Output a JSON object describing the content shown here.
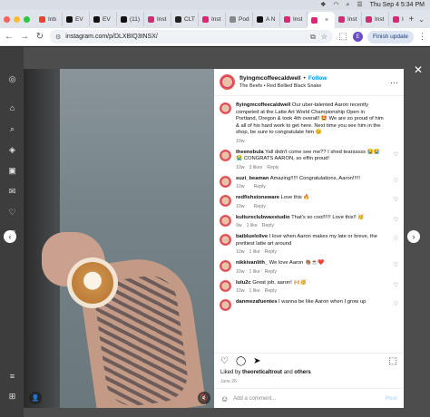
{
  "menubar": {
    "datetime": "Thu Sep 4  5:34 PM"
  },
  "tabs": [
    {
      "label": "Inb",
      "color": "#ea4335",
      "active": false
    },
    {
      "label": "EV",
      "color": "#111111",
      "active": false
    },
    {
      "label": "EV",
      "color": "#111111",
      "active": false
    },
    {
      "label": "(11)",
      "color": "#111111",
      "active": false
    },
    {
      "label": "Inst",
      "color": "#d62976",
      "active": false
    },
    {
      "label": "CLT",
      "color": "#222222",
      "active": false
    },
    {
      "label": "Inst",
      "color": "#d62976",
      "active": false
    },
    {
      "label": "Pod",
      "color": "#888888",
      "active": false
    },
    {
      "label": "A N",
      "color": "#111111",
      "active": false
    },
    {
      "label": "Inst",
      "color": "#d62976",
      "active": false
    },
    {
      "label": "",
      "color": "#d62976",
      "active": true
    },
    {
      "label": "Inst",
      "color": "#d62976",
      "active": false
    },
    {
      "label": "Inst",
      "color": "#d62976",
      "active": false
    },
    {
      "label": "Inst",
      "color": "#d62976",
      "active": false
    }
  ],
  "address": {
    "url": "instagram.com/p/DLXBIQ3tNSX/",
    "finish_update": "Finish update",
    "profile_initial": "E"
  },
  "post": {
    "username": "flyingmcoffeecaldwell",
    "follow": "Follow",
    "audio": "The Beefs • Red Bellied Black Snake",
    "caption_user": "flyingmcoffeecaldwell",
    "caption": "Our uber-talented Aaron recently competed at the Latte Art World Championship Open in Portland, Oregon & took 4th overall! 🤩 We are so proud of him & all of his hard work to get here. Next time you see him in the shop, be sure to congratulate him 😊",
    "caption_age": "10w",
    "likes_prefix": "Liked by",
    "likes_user": "theoreticaltrout",
    "likes_and": "and",
    "likes_others": "others",
    "date": "June 26",
    "add_comment_placeholder": "Add a comment...",
    "post_label": "Post"
  },
  "comments": [
    {
      "user": "theenebula",
      "text": "Yall didn't come see me?? I shed tearsssss 😭😭😭 CONGRATS AARON, so effin proud!",
      "age": "10w",
      "likes": "3 likes",
      "reply": "Reply"
    },
    {
      "user": "suzi_beaman",
      "text": "Amazing!!!!! Congratulations, Aaron!!!!!",
      "age": "10w",
      "likes": "",
      "reply": "Reply"
    },
    {
      "user": "redfishstoneware",
      "text": "Love this 🔥",
      "age": "10w",
      "likes": "",
      "reply": "Reply"
    },
    {
      "user": "kultureclubwaxstudio",
      "text": "That's so cool!!!!! Love this!! 🥳",
      "age": "9w",
      "likes": "1 like",
      "reply": "Reply"
    },
    {
      "user": "baibluelolive",
      "text": "I love when Aaron makes my late or breve, the prettiest latte art around",
      "age": "10w",
      "likes": "1 like",
      "reply": "Reply"
    },
    {
      "user": "nikkivanlith_",
      "text": "We love Aaron 👏🏽☕❤️",
      "age": "10w",
      "likes": "1 like",
      "reply": "Reply"
    },
    {
      "user": "lulu2c",
      "text": "Great job, aaron! 🙌🏼🥳",
      "age": "10w",
      "likes": "1 like",
      "reply": "Reply"
    },
    {
      "user": "danmezafuentes",
      "text": "I wanna be like Aaron when I grow up",
      "age": "",
      "likes": "",
      "reply": ""
    }
  ],
  "icons": {
    "close": "✕",
    "prev": "‹",
    "next": "›",
    "heart": "♡",
    "comment": "◯",
    "share": "➤",
    "save": "⬚",
    "more": "···"
  }
}
